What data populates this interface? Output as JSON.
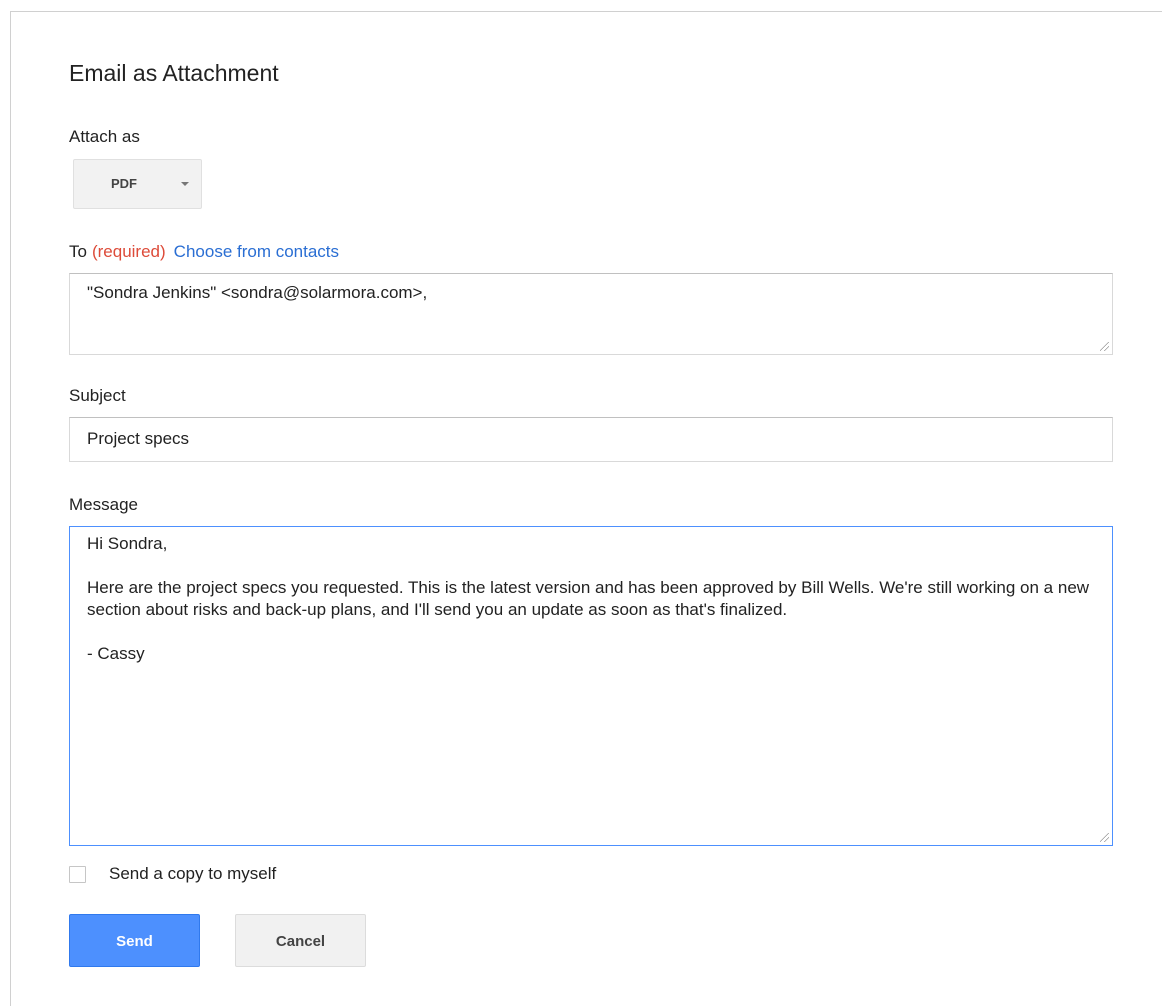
{
  "dialog": {
    "title": "Email as Attachment",
    "attach": {
      "label": "Attach as",
      "selected_format": "PDF"
    },
    "to": {
      "label": "To",
      "required_text": "(required)",
      "contacts_link": "Choose from contacts",
      "value": "\"Sondra Jenkins\" <sondra@solarmora.com>,"
    },
    "subject": {
      "label": "Subject",
      "value": "Project specs"
    },
    "message": {
      "label": "Message",
      "value": "Hi Sondra,\n\nHere are the project specs you requested. This is the latest version and has been approved by Bill Wells. We're still working on a new section about risks and back-up plans, and I'll send you an update as soon as that's finalized.\n\n- Cassy"
    },
    "copy_to_self": {
      "label": "Send a copy to myself",
      "checked": false
    },
    "buttons": {
      "send": "Send",
      "cancel": "Cancel"
    }
  },
  "colors": {
    "accent": "#4d90fe",
    "required": "#dd4b39",
    "link": "#2a6ed3"
  },
  "icons": {
    "format_dropdown": "caret-down-icon",
    "textarea_resize": "resize-grip-icon"
  }
}
